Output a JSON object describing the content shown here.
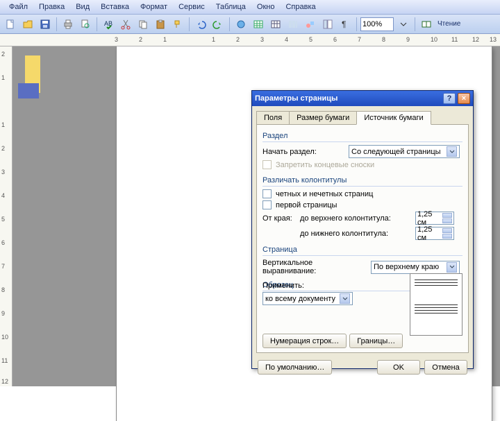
{
  "menu": [
    "Файл",
    "Правка",
    "Вид",
    "Вставка",
    "Формат",
    "Сервис",
    "Таблица",
    "Окно",
    "Справка"
  ],
  "zoom": "100%",
  "ruler_h": [
    "3",
    "2",
    "1",
    "1",
    "2",
    "3",
    "4",
    "5",
    "6",
    "7",
    "8",
    "9",
    "10",
    "11",
    "12",
    "13"
  ],
  "ruler_v": [
    "2",
    "1",
    "1",
    "2",
    "3",
    "4",
    "5",
    "6",
    "7",
    "8",
    "9",
    "10",
    "11",
    "12"
  ],
  "dialog": {
    "title": "Параметры страницы",
    "tabs": [
      "Поля",
      "Размер бумаги",
      "Источник бумаги"
    ],
    "section": {
      "group": "Раздел",
      "start_label": "Начать раздел:",
      "start_value": "Со следующей страницы",
      "suppress_endnotes": "Запретить концевые сноски"
    },
    "headers": {
      "group": "Различать колонтитулы",
      "odd_even": "четных и нечетных страниц",
      "first": "первой страницы",
      "from_edge": "От края:",
      "to_header": "до верхнего колонтитула:",
      "to_footer": "до нижнего колонтитула:",
      "header_val": "1,25 см",
      "footer_val": "1,25 см"
    },
    "page": {
      "group": "Страница",
      "valign_label": "Вертикальное выравнивание:",
      "valign_value": "По верхнему краю"
    },
    "preview": {
      "group": "Образец",
      "apply_label": "Применить:",
      "apply_value": "ко всему документу"
    },
    "line_numbers": "Нумерация строк…",
    "borders": "Границы…",
    "default": "По умолчанию…",
    "ok": "OK",
    "cancel": "Отмена"
  }
}
